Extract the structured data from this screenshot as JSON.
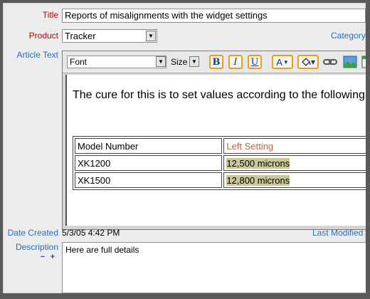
{
  "form": {
    "title": {
      "label": "Title",
      "value": "Reports of misalignments with the widget settings"
    },
    "product": {
      "label": "Product",
      "value": "Tracker"
    },
    "category": {
      "label": "Category"
    },
    "article_text": {
      "label": "Article Text"
    },
    "date_created": {
      "label": "Date Created",
      "value": "5/3/05 4:42 PM"
    },
    "last_modified": {
      "label": "Last Modified"
    },
    "description": {
      "label": "Description",
      "value": "Here are full details"
    }
  },
  "toolbar": {
    "font_value": "Font",
    "size_value": "Size",
    "bold_label": "B",
    "italic_label": "I",
    "underline_label": "U",
    "font_color_label": "A"
  },
  "editor": {
    "paragraph": "The cure for this is to set values according to the following",
    "table": {
      "headers": [
        "Model Number",
        "Left Setting"
      ],
      "rows": [
        [
          "XK1200",
          "12,500 microns"
        ],
        [
          "XK1500",
          "12,800 microns"
        ]
      ]
    }
  },
  "colors": {
    "required_label": "#c00000",
    "optional_label": "#2a6ebb",
    "highlight": "#c8c89a",
    "header_accent": "#c0603a"
  }
}
